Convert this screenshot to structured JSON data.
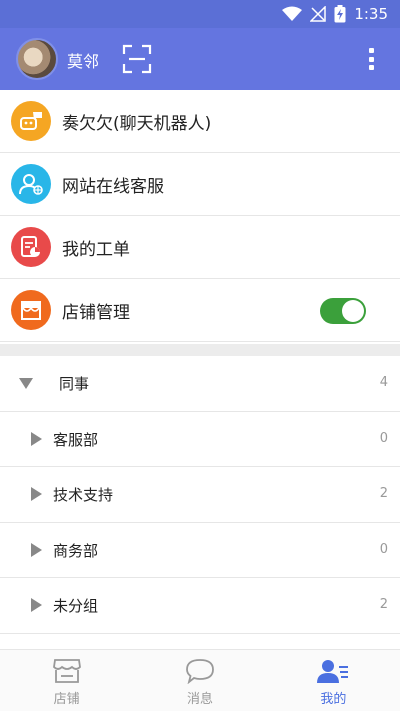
{
  "status_bar": {
    "time": "1:35"
  },
  "header": {
    "username": "莫邻"
  },
  "menu": {
    "items": [
      {
        "label": "奏欠欠(聊天机器人)",
        "icon": "robot-chat-icon",
        "color": "#f5a623"
      },
      {
        "label": "网站在线客服",
        "icon": "online-service-icon",
        "color": "#29b6e8"
      },
      {
        "label": "我的工单",
        "icon": "work-order-icon",
        "color": "#e84a4a"
      },
      {
        "label": "店铺管理",
        "icon": "store-icon",
        "color": "#f06a1e",
        "toggle_on": true
      }
    ]
  },
  "groups": [
    {
      "name": "同事",
      "count": "4",
      "expanded": true
    },
    {
      "name": "客服部",
      "count": "0"
    },
    {
      "name": "技术支持",
      "count": "2"
    },
    {
      "name": "商务部",
      "count": "0"
    },
    {
      "name": "未分组",
      "count": "2"
    }
  ],
  "tabs": [
    {
      "label": "店铺",
      "icon": "store-tab-icon"
    },
    {
      "label": "消息",
      "icon": "chat-bubble-icon"
    },
    {
      "label": "我的",
      "icon": "contacts-icon",
      "active": true
    }
  ],
  "colors": {
    "header": "#6475e0",
    "accent": "#4a6fe0",
    "toggle": "#3ba03b"
  }
}
